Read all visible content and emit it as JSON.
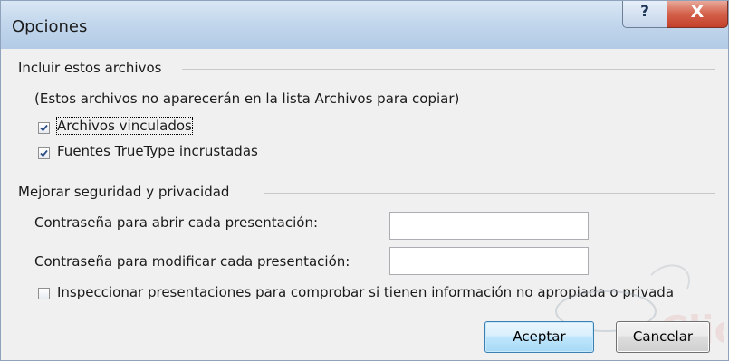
{
  "window": {
    "title": "Opciones",
    "help_icon": "help-icon",
    "help_glyph": "?",
    "close_icon": "close-icon",
    "close_glyph": "X"
  },
  "include_group": {
    "title": "Incluir estos archivos",
    "note": "(Estos archivos no aparecerán en la lista Archivos para copiar)",
    "linked_files": {
      "label": "Archivos vinculados",
      "checked": true
    },
    "truetype_fonts": {
      "label": "Fuentes TrueType incrustadas",
      "checked": true
    }
  },
  "security_group": {
    "title": "Mejorar seguridad y privacidad",
    "open_password": {
      "label": "Contraseña para abrir cada presentación:",
      "value": ""
    },
    "modify_password": {
      "label": "Contraseña para modificar cada presentación:",
      "value": ""
    },
    "inspect": {
      "label": "Inspeccionar presentaciones para comprobar si tienen información no apropiada o privada",
      "checked": false
    }
  },
  "buttons": {
    "ok": "Aceptar",
    "cancel": "Cancelar"
  },
  "colors": {
    "title_bar": "#c3d7ec",
    "close_button": "#c4402b",
    "default_button_border": "#3c7fb1",
    "background": "#f0f0f0"
  }
}
